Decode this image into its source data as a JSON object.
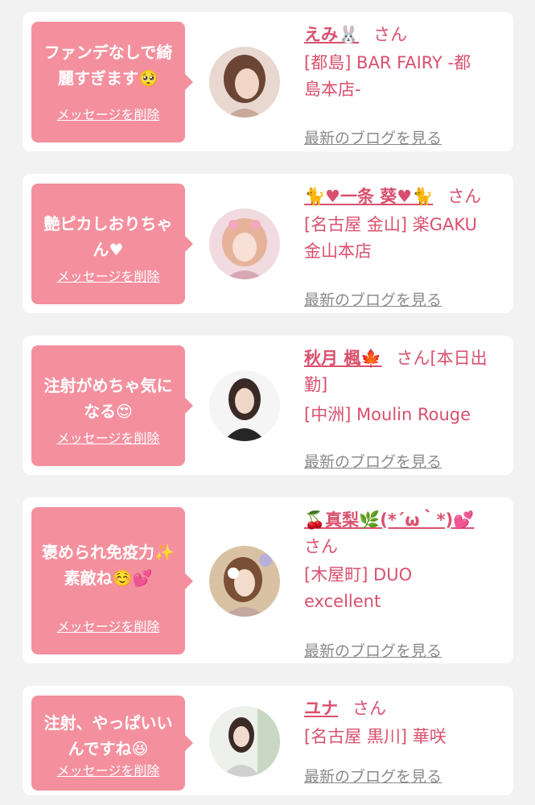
{
  "colors": {
    "background": "#f2f2f2",
    "card": "#ffffff",
    "bubble": "#f4909e",
    "accent_text": "#d9506e",
    "muted_link": "#8a8a8a"
  },
  "cards": [
    {
      "message_lines": [
        "ファンデなしで綺",
        "麗すぎます🥺"
      ],
      "delete_label": "メッセージを削除",
      "name": "えみ🐰",
      "honorific": "さん",
      "shop_lines": [
        "[都島] BAR FAIRY -都",
        "島本店-"
      ],
      "blog_label": "最新のブログを見る"
    },
    {
      "message_lines": [
        "艶ピカしおりちゃ",
        "ん♥"
      ],
      "delete_label": "メッセージを削除",
      "name": "🐈♥一条 葵♥🐈",
      "honorific": "さん",
      "shop_lines": [
        "[名古屋 金山] 楽GAKU",
        "金山本店"
      ],
      "blog_label": "最新のブログを見る"
    },
    {
      "message_lines": [
        "注射がめちゃ気に",
        "なる😍"
      ],
      "delete_label": "メッセージを削除",
      "name": "秋月 楓🍁",
      "honorific": "さん[本日出",
      "name_line2": "勤]",
      "shop_lines": [
        "[中洲] Moulin Rouge"
      ],
      "blog_label": "最新のブログを見る"
    },
    {
      "message_lines": [
        "褒められ免疫力✨",
        "素敵ね☺️💕"
      ],
      "delete_label": "メッセージを削除",
      "name": "🍒真梨🌿(*´ω｀*)💕",
      "honorific": "",
      "name_line2": "さん",
      "shop_lines": [
        "[木屋町] DUO",
        "excellent"
      ],
      "blog_label": "最新のブログを見る"
    },
    {
      "message_lines": [
        "注射、やっぱいい",
        "んですね😆"
      ],
      "delete_label": "メッセージを削除",
      "name": "ユナ",
      "honorific": "さん",
      "shop_lines": [
        "[名古屋 黒川] 華咲"
      ],
      "blog_label": "最新のブログを見る"
    }
  ]
}
